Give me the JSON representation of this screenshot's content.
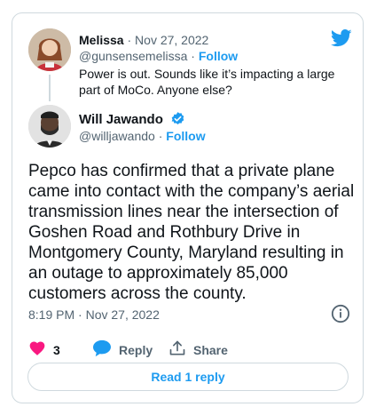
{
  "parent": {
    "name": "Melissa",
    "separator": "·",
    "date": "Nov 27, 2022",
    "handle": "@gunsensemelissa",
    "follow": "Follow",
    "text": "Power is out. Sounds like it’s impacting a large part of MoCo. Anyone else?"
  },
  "reply": {
    "name": "Will Jawando",
    "handle": "@willjawando",
    "follow": "Follow",
    "text": "Pepco has confirmed that a private plane came into contact with the company’s aerial transmission lines near the intersection of Goshen Road and Rothbury Drive in Montgomery County, Maryland resulting in an outage to approximately 85,000 customers across the county.",
    "timestamp": "8:19 PM · Nov 27, 2022"
  },
  "actions": {
    "likes_count": "3",
    "reply_label": "Reply",
    "share_label": "Share"
  },
  "read_replies": "Read 1 reply",
  "colors": {
    "brand_blue": "#1d9bf0",
    "like_pink": "#f91880",
    "muted": "#536471",
    "border": "#cfd9de"
  },
  "icons": {
    "brand": "twitter-bird-icon",
    "verified": "verified-badge-icon",
    "info": "info-icon",
    "like": "heart-icon",
    "reply": "reply-bubble-icon",
    "share": "share-upload-icon"
  }
}
